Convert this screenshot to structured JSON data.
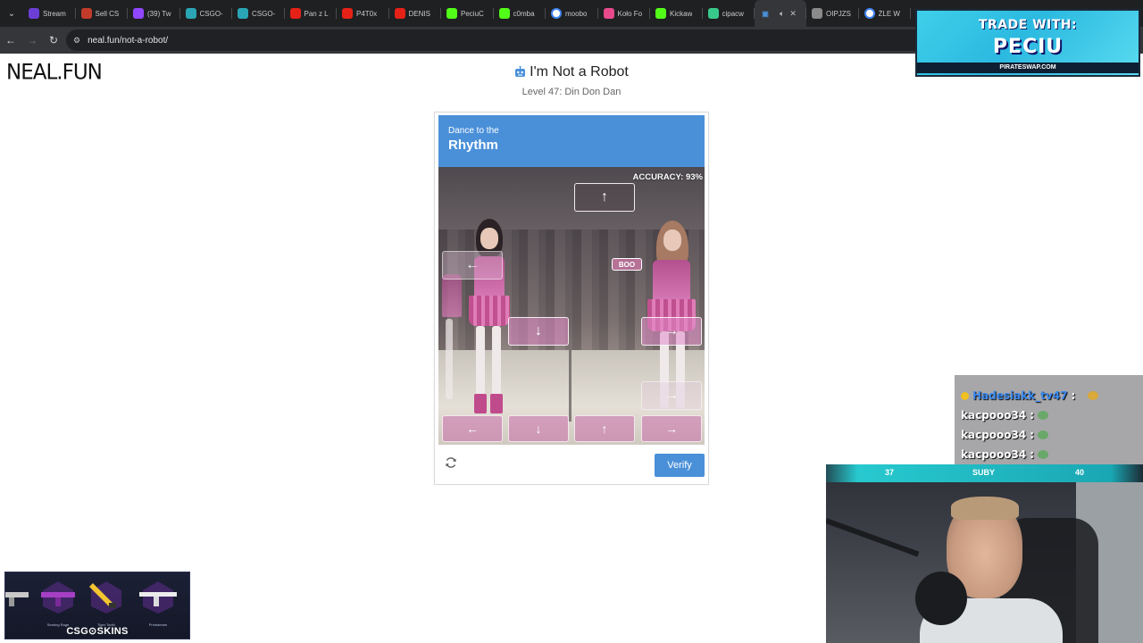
{
  "browser": {
    "tabs": [
      {
        "label": "Stream",
        "icon": "streamlabs-icon",
        "color": "#6b3fd6"
      },
      {
        "label": "Sell CS",
        "icon": "sell-icon",
        "color": "#c23b2b"
      },
      {
        "label": "(39) Tw",
        "icon": "twitch-icon",
        "color": "#9146ff"
      },
      {
        "label": "CSGO-",
        "icon": "csgo-icon",
        "color": "#2aa5b5"
      },
      {
        "label": "CSGO-",
        "icon": "csgo-icon",
        "color": "#2aa5b5"
      },
      {
        "label": "Pan z L",
        "icon": "youtube-icon",
        "color": "#e62117"
      },
      {
        "label": "P4T0x",
        "icon": "youtube-icon",
        "color": "#e62117"
      },
      {
        "label": "DENIS",
        "icon": "youtube-icon",
        "color": "#e62117"
      },
      {
        "label": "PeciuC",
        "icon": "kick-icon",
        "color": "#53fc18"
      },
      {
        "label": "c0mba",
        "icon": "kick-icon",
        "color": "#53fc18"
      },
      {
        "label": "moobo",
        "icon": "google-icon",
        "color": "#ffffff"
      },
      {
        "label": "Koło Fo",
        "icon": "wheel-icon",
        "color": "#e64a8b"
      },
      {
        "label": "Kickaw",
        "icon": "kick-icon",
        "color": "#53fc18"
      },
      {
        "label": "cipacw",
        "icon": "site-icon",
        "color": "#38c98a"
      },
      {
        "label": "",
        "icon": "robot-icon",
        "color": "#4a90d9",
        "active": true
      },
      {
        "label": "OIPJZS",
        "icon": "globe-icon",
        "color": "#8a8a8a"
      },
      {
        "label": "ŻLE W",
        "icon": "google-icon",
        "color": "#ffffff"
      }
    ],
    "url": "neal.fun/not-a-robot/"
  },
  "site": {
    "logo": "NEAL.FUN"
  },
  "page": {
    "title": "I'm Not a Robot",
    "level": "Level 47: Din Don Dan"
  },
  "captcha": {
    "header_line1": "Dance to the",
    "header_line2": "Rhythm",
    "accuracy": "ACCURACY: 93%",
    "boo_label": "BOO",
    "notes": [
      "↑",
      "←",
      "↓",
      "→",
      "→"
    ],
    "targets": [
      "←",
      "↓",
      "↑",
      "→"
    ],
    "verify_label": "Verify",
    "accent": "#4a90d9"
  },
  "overlay": {
    "promo_top": "TRADE WITH:",
    "promo_name": "PECIU",
    "promo_url": "PIRATESWAP.COM",
    "chat": [
      {
        "user": "Hadesiakk_tv47",
        "sep": ":"
      },
      {
        "user": "kacpooo34",
        "sep": ":"
      },
      {
        "user": "kacpooo34",
        "sep": ":"
      },
      {
        "user": "kacpooo34",
        "sep": ":"
      }
    ],
    "cam_bar_left": "37",
    "cam_bar_mid": "SUBY",
    "cam_bar_right": "40",
    "skins": [
      "",
      "Searing Rage",
      "Tiger Tooth",
      "Printstream"
    ],
    "skins_logo": "CSG⊙SKINS"
  }
}
